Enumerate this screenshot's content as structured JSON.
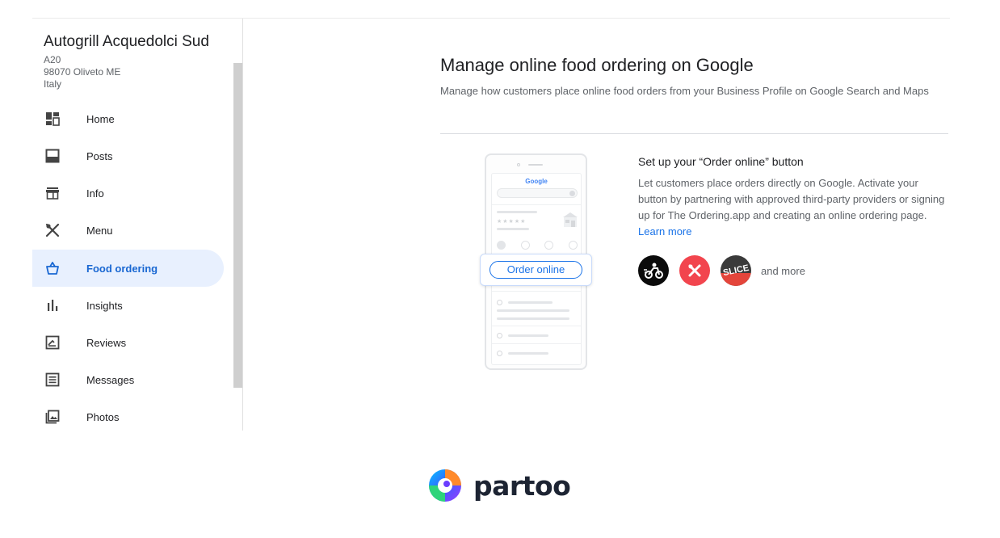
{
  "business": {
    "name": "Autogrill Acquedolci Sud",
    "address_line1": "A20",
    "address_line2": "98070 Oliveto ME",
    "country": "Italy"
  },
  "sidebar": {
    "items": [
      {
        "label": "Home",
        "icon": "dashboard-icon"
      },
      {
        "label": "Posts",
        "icon": "posts-icon"
      },
      {
        "label": "Info",
        "icon": "storefront-icon"
      },
      {
        "label": "Menu",
        "icon": "utensils-icon"
      },
      {
        "label": "Food ordering",
        "icon": "food-ordering-icon",
        "active": true
      },
      {
        "label": "Insights",
        "icon": "bar-chart-icon"
      },
      {
        "label": "Reviews",
        "icon": "reviews-icon"
      },
      {
        "label": "Messages",
        "icon": "messages-icon"
      },
      {
        "label": "Photos",
        "icon": "photos-icon"
      }
    ]
  },
  "main": {
    "title": "Manage online food ordering on Google",
    "description": "Manage how customers place online food orders from your Business Profile on Google Search and Maps",
    "illustration": {
      "google_label": "Google",
      "order_button": "Order online"
    },
    "setup": {
      "title": "Set up your “Order online” button",
      "description": "Let customers place orders directly on Google. Activate your button by partnering with approved third-party providers or signing up for The Ordering.app and creating an online ordering page.",
      "learn_more": "Learn more"
    },
    "providers": {
      "logo_3_text": "SLICE",
      "and_more": "and more"
    }
  },
  "footer": {
    "logo_text": "partoo"
  },
  "colors": {
    "accent_blue": "#1a73e8",
    "active_bg": "#e8f0fe",
    "active_text": "#1967d2"
  }
}
